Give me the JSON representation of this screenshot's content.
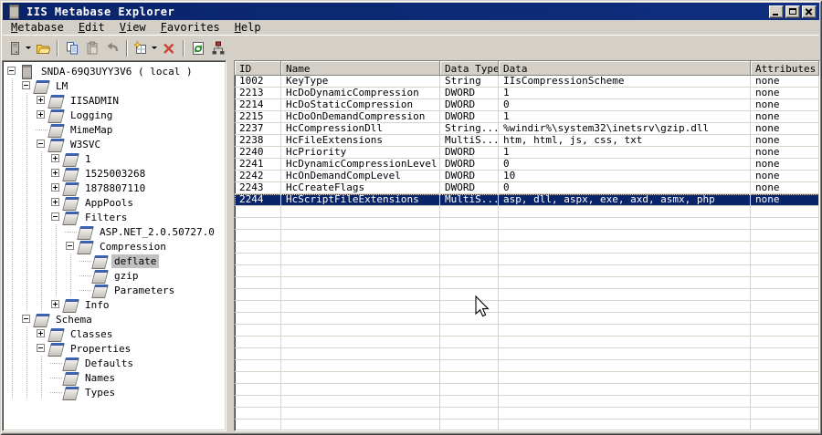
{
  "window": {
    "title": "IIS Metabase Explorer"
  },
  "titlebar": {
    "icon": "server-icon",
    "buttons": [
      "minimize",
      "maximize",
      "close"
    ]
  },
  "menu": {
    "items": [
      {
        "hot": "M",
        "rest": "etabase"
      },
      {
        "hot": "E",
        "rest": "dit"
      },
      {
        "hot": "V",
        "rest": "iew"
      },
      {
        "hot": "F",
        "rest": "avorites"
      },
      {
        "hot": "H",
        "rest": "elp"
      }
    ]
  },
  "toolbar": {
    "buttons": [
      {
        "icon": "connect-server",
        "dropdown": true,
        "disabled": false
      },
      {
        "icon": "open-folder",
        "dropdown": false,
        "disabled": false
      },
      {
        "icon": "copy",
        "dropdown": false,
        "disabled": false
      },
      {
        "icon": "paste",
        "dropdown": false,
        "disabled": true
      },
      {
        "icon": "undo",
        "dropdown": false,
        "disabled": true
      },
      {
        "icon": "new-key",
        "dropdown": true,
        "disabled": false
      },
      {
        "icon": "delete",
        "dropdown": false,
        "disabled": false
      },
      {
        "icon": "refresh",
        "dropdown": false,
        "disabled": false
      },
      {
        "icon": "hierarchy-view",
        "dropdown": false,
        "disabled": false
      }
    ]
  },
  "tree": {
    "items": [
      {
        "label": "SNDA-69Q3UYY3V6 ( local )",
        "level": 0,
        "expand": "minus",
        "icon": "server",
        "selected": false
      },
      {
        "label": "LM",
        "level": 1,
        "expand": "minus",
        "icon": "key",
        "selected": false
      },
      {
        "label": "IISADMIN",
        "level": 2,
        "expand": "plus",
        "icon": "key",
        "selected": false
      },
      {
        "label": "Logging",
        "level": 2,
        "expand": "plus",
        "icon": "key",
        "selected": false
      },
      {
        "label": "MimeMap",
        "level": 2,
        "expand": "none",
        "icon": "key",
        "selected": false
      },
      {
        "label": "W3SVC",
        "level": 2,
        "expand": "minus",
        "icon": "key",
        "selected": false
      },
      {
        "label": "1",
        "level": 3,
        "expand": "plus",
        "icon": "key",
        "selected": false
      },
      {
        "label": "1525003268",
        "level": 3,
        "expand": "plus",
        "icon": "key",
        "selected": false
      },
      {
        "label": "1878807110",
        "level": 3,
        "expand": "plus",
        "icon": "key",
        "selected": false
      },
      {
        "label": "AppPools",
        "level": 3,
        "expand": "plus",
        "icon": "key",
        "selected": false
      },
      {
        "label": "Filters",
        "level": 3,
        "expand": "minus",
        "icon": "key",
        "selected": false
      },
      {
        "label": "ASP.NET_2.0.50727.0",
        "level": 4,
        "expand": "none",
        "icon": "key",
        "selected": false
      },
      {
        "label": "Compression",
        "level": 4,
        "expand": "minus",
        "icon": "key",
        "selected": false
      },
      {
        "label": "deflate",
        "level": 5,
        "expand": "none",
        "icon": "key",
        "selected": true
      },
      {
        "label": "gzip",
        "level": 5,
        "expand": "none",
        "icon": "key",
        "selected": false
      },
      {
        "label": "Parameters",
        "level": 5,
        "expand": "none",
        "icon": "key",
        "selected": false
      },
      {
        "label": "Info",
        "level": 3,
        "expand": "plus",
        "icon": "key",
        "selected": false
      },
      {
        "label": "Schema",
        "level": 1,
        "expand": "minus",
        "icon": "key",
        "selected": false
      },
      {
        "label": "Classes",
        "level": 2,
        "expand": "plus",
        "icon": "key",
        "selected": false
      },
      {
        "label": "Properties",
        "level": 2,
        "expand": "minus",
        "icon": "key",
        "selected": false
      },
      {
        "label": "Defaults",
        "level": 3,
        "expand": "none",
        "icon": "key",
        "selected": false
      },
      {
        "label": "Names",
        "level": 3,
        "expand": "none",
        "icon": "key",
        "selected": false
      },
      {
        "label": "Types",
        "level": 3,
        "expand": "none",
        "icon": "key",
        "selected": false
      }
    ]
  },
  "list": {
    "columns": [
      "ID",
      "Name",
      "Data Type",
      "Data",
      "Attributes"
    ],
    "rows": [
      [
        "1002",
        "KeyType",
        "String",
        "IIsCompressionScheme",
        "none"
      ],
      [
        "2213",
        "HcDoDynamicCompression",
        "DWORD",
        "1",
        "none"
      ],
      [
        "2214",
        "HcDoStaticCompression",
        "DWORD",
        "0",
        "none"
      ],
      [
        "2215",
        "HcDoOnDemandCompression",
        "DWORD",
        "1",
        "none"
      ],
      [
        "2237",
        "HcCompressionDll",
        "String...",
        "%windir%\\system32\\inetsrv\\gzip.dll",
        "none"
      ],
      [
        "2238",
        "HcFileExtensions",
        "MultiS...",
        "htm, html, js, css, txt",
        "none"
      ],
      [
        "2240",
        "HcPriority",
        "DWORD",
        "1",
        "none"
      ],
      [
        "2241",
        "HcDynamicCompressionLevel",
        "DWORD",
        "0",
        "none"
      ],
      [
        "2242",
        "HcOnDemandCompLevel",
        "DWORD",
        "10",
        "none"
      ],
      [
        "2243",
        "HcCreateFlags",
        "DWORD",
        "0",
        "none"
      ],
      [
        "2244",
        "HcScriptFileExtensions",
        "MultiS...",
        "asp, dll, aspx, exe, axd, asmx, php",
        "none"
      ]
    ],
    "selected_row_index": 10
  },
  "colors": {
    "titlebar": "#0a246a",
    "selection": "#0a246a",
    "chrome": "#d4d0c8",
    "grid_line": "#d8d4ca",
    "tree_selection": "#c0c0c0"
  }
}
